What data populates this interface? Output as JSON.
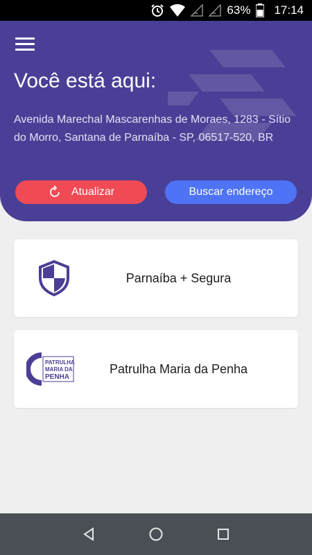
{
  "status_bar": {
    "battery_percent": "63%",
    "time": "17:14",
    "icons": [
      "alarm-icon",
      "wifi-icon",
      "signal-icon",
      "signal-icon",
      "battery-icon"
    ]
  },
  "header": {
    "title": "Você está aqui:",
    "address": "Avenida Marechal Mascarenhas de Moraes, 1283 - Sítio do Morro, Santana de Parnaíba - SP, 06517-520, BR",
    "refresh_label": "Atualizar",
    "search_label": "Buscar endereço",
    "colors": {
      "background": "#4a3f96",
      "refresh": "#f04a55",
      "search": "#4e73f5"
    }
  },
  "cards": [
    {
      "label": "Parnaíba + Segura",
      "icon": "shield-icon"
    },
    {
      "label": "Patrulha Maria da Penha",
      "icon": "patrulha-logo",
      "logo_text": [
        "PATRULHA",
        "MARIA DA",
        "PENHA"
      ]
    }
  ],
  "nav_bar": {
    "icons": [
      "back-icon",
      "home-icon",
      "recents-icon"
    ]
  }
}
